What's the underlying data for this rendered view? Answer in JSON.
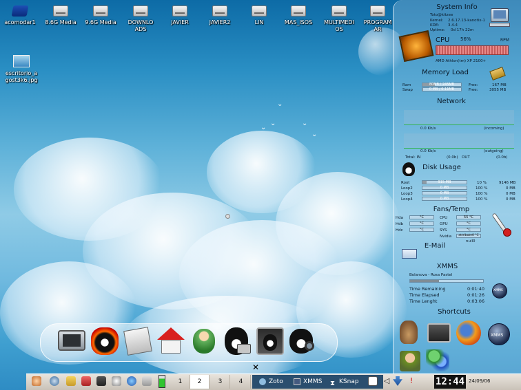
{
  "desktop": {
    "icons": [
      {
        "label": "acomodar1"
      },
      {
        "label": "8.6G Media"
      },
      {
        "label": "9.6G Media"
      },
      {
        "label": "DOWNLOADS"
      },
      {
        "label": "JAVIER"
      },
      {
        "label": "JAVIER2"
      },
      {
        "label": "LIN"
      },
      {
        "label": "MAS_ISOS"
      },
      {
        "label": "MULTIMEDIOS"
      },
      {
        "label": "PROGRAMAR"
      },
      {
        "label": "escritorio_agost3k6.jpg"
      }
    ]
  },
  "sysinfo": {
    "title": "System Info",
    "user": "Toto@kitzee",
    "kernel_label": "Kernel:",
    "kernel": "2.6.17.13-kanotix-1",
    "kde_label": "KDE:",
    "kde": "3.4.4",
    "uptime_label": "Uptime:",
    "uptime": "0d 17h 22m"
  },
  "cpu": {
    "title": "CPU",
    "percent": "56%",
    "rpm_label": "RPM",
    "model": "AMD Athlon(tm) XP 2100+"
  },
  "memory": {
    "title": "Memory Load",
    "rows": [
      {
        "label": "Ram",
        "bar": "80MB / 245MB",
        "free_label": "Free:",
        "free": "167 MB",
        "fill": 0.32
      },
      {
        "label": "Swap",
        "bar": "0 MB / 0.11MB",
        "free_label": "Free:",
        "free": "3055 MB",
        "fill": 0.02
      }
    ]
  },
  "network": {
    "title": "Network",
    "in_rate": "0.0 Kb/s",
    "in_label": "(incoming)",
    "out_rate": "0.0 Kb/s",
    "out_label": "(outgoing)",
    "total_in_label": "Total: IN",
    "total_in": "(0.0b)",
    "total_out_label": "OUT",
    "total_out": "(0.0b)"
  },
  "disk": {
    "title": "Disk Usage",
    "rows": [
      {
        "label": "Root",
        "bar": "915 MB",
        "pct": "10 %",
        "size": "9146 MB",
        "fill": 0.1
      },
      {
        "label": "Loop2",
        "bar": "0 MB",
        "pct": "100 %",
        "size": "0 MB",
        "fill": 0.0
      },
      {
        "label": "Loop3",
        "bar": "0 MB",
        "pct": "100 %",
        "size": "0 MB",
        "fill": 0.0
      },
      {
        "label": "Loop4",
        "bar": "0 MB",
        "pct": "100 %",
        "size": "0 MB",
        "fill": 0.0
      }
    ]
  },
  "fans": {
    "title": "Fans/Temp",
    "left": [
      {
        "label": "Hda",
        "val": "°C"
      },
      {
        "label": "Hdb",
        "val": "°C"
      },
      {
        "label": "Hdc",
        "val": "°C"
      }
    ],
    "right": [
      {
        "label": "CPU",
        "val": "55 °C"
      },
      {
        "label": "GPU",
        "val": "°C"
      },
      {
        "label": "SYS",
        "val": "°C"
      },
      {
        "label": "Nvidia",
        "val": "attribute0 °C"
      }
    ],
    "extra": "null0"
  },
  "email": {
    "title": "E-Mail"
  },
  "xmms": {
    "title": "XMMS",
    "song": "Bolanova - Rosa Pastel",
    "progress": 0.4,
    "rows": [
      {
        "label": "Time Remaining",
        "val": "0:01:40"
      },
      {
        "label": "Time Elapsed",
        "val": "0:01:26"
      },
      {
        "label": "Time Lenght",
        "val": "0:03:06"
      }
    ],
    "badge": "XMMS"
  },
  "shortcuts": {
    "title": "Shortcuts",
    "badge": "XMMS"
  },
  "dock": {
    "icons": [
      "monitor-icon",
      "tux-fire-icon",
      "tux-mail-icon",
      "home-icon",
      "messenger-icon",
      "tux-camera-icon",
      "tux-settings-icon",
      "tux-search-icon"
    ]
  },
  "taskbar": {
    "desktops": [
      "1",
      "2",
      "3",
      "4"
    ],
    "active_desktop": "2",
    "tasks": [
      {
        "label": "Zoto"
      },
      {
        "label": "XMMS"
      },
      {
        "label": "KSnap"
      }
    ],
    "clock": "12:44",
    "date": "24/09/06"
  }
}
